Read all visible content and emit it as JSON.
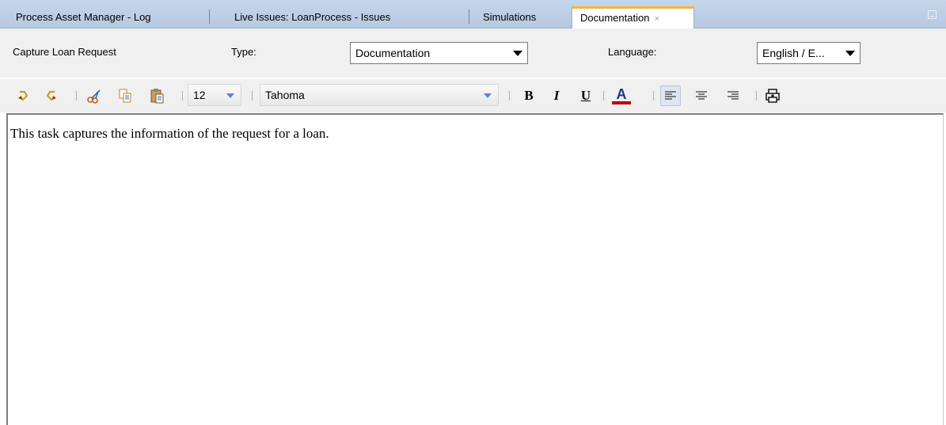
{
  "tabs": [
    {
      "label": "Process Asset Manager - Log",
      "active": false
    },
    {
      "label": "Live Issues: LoanProcess - Issues",
      "active": false
    },
    {
      "label": "Simulations",
      "active": false
    },
    {
      "label": "Documentation",
      "active": true,
      "close": "×"
    }
  ],
  "properties": {
    "task_name": "Capture Loan Request",
    "type_label": "Type:",
    "type_value": "Documentation",
    "language_label": "Language:",
    "language_value": "English / E..."
  },
  "toolbar": {
    "font_size": "12",
    "font_family": "Tahoma",
    "bold": "B",
    "italic": "I",
    "underline": "U",
    "font_color_letter": "A",
    "font_color": "#c00000",
    "icons": [
      "undo-icon",
      "redo-icon",
      "cut-icon",
      "copy-icon",
      "paste-icon",
      "align-left-icon",
      "align-center-icon",
      "align-right-icon",
      "insert-icon"
    ]
  },
  "editor": {
    "text": "This task captures the information of the request for a loan."
  },
  "colors": {
    "tab_bar": "#c5d6ea",
    "active_tab_accent": "#f2b53a",
    "panel_bg": "#f0f0f0"
  }
}
